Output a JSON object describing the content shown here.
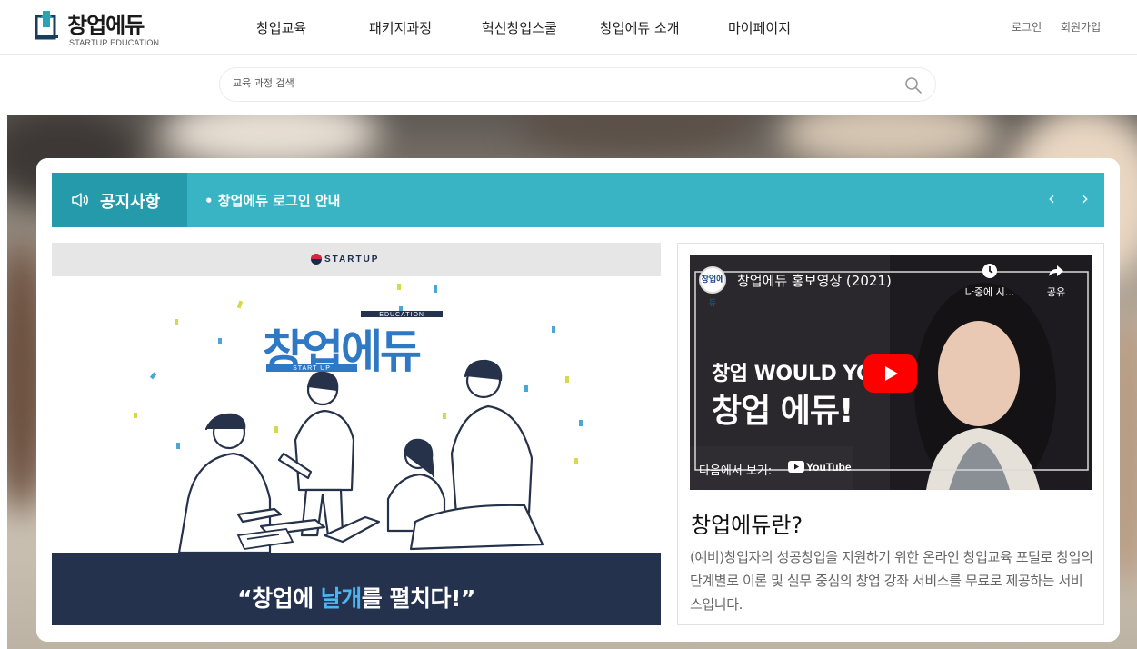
{
  "logo": {
    "name": "창업에듀",
    "sub": "STARTUP EDUCATION"
  },
  "nav": [
    "창업교육",
    "패키지과정",
    "혁신창업스쿨",
    "창업에듀 소개",
    "마이페이지"
  ],
  "util": {
    "login": "로그인",
    "signup": "회원가입"
  },
  "search": {
    "placeholder": "교육 과정 검색"
  },
  "notice": {
    "title": "공지사항",
    "item": "• 창업에듀 로그인 안내",
    "prev": "‹",
    "next": "›"
  },
  "banner": {
    "brand": "STARTUP",
    "logo_main": "창업에듀",
    "logo_tag_top": "EDUCATION",
    "logo_tag_bottom": "START UP",
    "slogan_pre": "“창업에 ",
    "slogan_highlight": "날개",
    "slogan_post": "를 펼치다!”"
  },
  "video": {
    "channel_badge": "창업에듀",
    "title": "창업에듀 홍보영상 (2021)",
    "watch_later": "나중에 시...",
    "share": "공유",
    "headline1": "창업 WOULD YOU",
    "headline2": "창업 에듀!",
    "watch_on": "다음에서 보기:",
    "youtube": "YouTube"
  },
  "about": {
    "title": "창업에듀란?",
    "text": "(예비)창업자의 성공창업을 지원하기 위한 온라인 창업교육 포털로 창업의 단계별로 이론 및 실무 중심의 창업 강좌 서비스를 무료로 제공하는 서비스입니다."
  },
  "colors": {
    "accent": "#38b4c4",
    "accent_dark": "#259aaa",
    "navy": "#24324e",
    "highlight": "#4fb3f0",
    "play": "#ff0000"
  }
}
